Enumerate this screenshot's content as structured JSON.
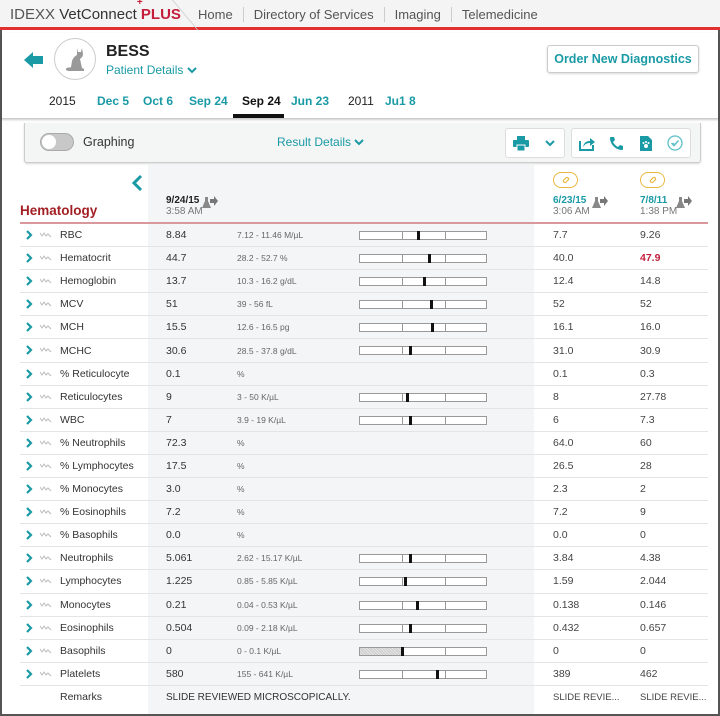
{
  "app": {
    "brand_prefix": "IDEXX",
    "brand_name": "VetConnect",
    "brand_suffix": "PLUS",
    "nav": [
      "Home",
      "Directory of Services",
      "Imaging",
      "Telemedicine"
    ]
  },
  "patient": {
    "name": "BESS",
    "details_label": "Patient Details",
    "order_button": "Order New Diagnostics"
  },
  "timeline": [
    {
      "label": "2015",
      "kind": "year"
    },
    {
      "label": "Dec 5",
      "kind": "date"
    },
    {
      "label": "Oct 6",
      "kind": "date"
    },
    {
      "label": "Sep 24",
      "kind": "date"
    },
    {
      "label": "Sep 24",
      "kind": "selected"
    },
    {
      "label": "Jun 23",
      "kind": "date"
    },
    {
      "label": "2011",
      "kind": "year"
    },
    {
      "label": "Ju1 8",
      "kind": "date"
    }
  ],
  "toolbar": {
    "graphing_label": "Graphing",
    "graphing_on": false,
    "result_details_label": "Result Details",
    "icons": [
      "print-icon",
      "chevron-down-icon",
      "share-icon",
      "phone-icon",
      "pet-document-icon",
      "check-circle-icon"
    ]
  },
  "columns": {
    "current": {
      "date": "9/24/15",
      "time": "3:58 AM"
    },
    "previous": [
      {
        "date": "6/23/15",
        "time": "3:06 AM"
      },
      {
        "date": "7/8/11",
        "time": "1:38 PM"
      }
    ]
  },
  "section": "Hematology",
  "colors": {
    "accent": "#1a9aa5",
    "section_red": "#a31f24",
    "high_value": "#c41e3a",
    "link_badge": "#e8b940"
  },
  "rows": [
    {
      "name": "RBC",
      "value": "8.84",
      "range": "7.12 - 11.46 M/µL",
      "marker": 0.46,
      "prev1": "7.7",
      "prev2": "9.26"
    },
    {
      "name": "Hematocrit",
      "value": "44.7",
      "range": "28.2 - 52.7 %",
      "marker": 0.55,
      "prev1": "40.0",
      "prev2": "47.9",
      "prev2_high": true
    },
    {
      "name": "Hemoglobin",
      "value": "13.7",
      "range": "10.3 - 16.2 g/dL",
      "marker": 0.51,
      "prev1": "12.4",
      "prev2": "14.8"
    },
    {
      "name": "MCV",
      "value": "51",
      "range": "39 - 56 fL",
      "marker": 0.56,
      "prev1": "52",
      "prev2": "52"
    },
    {
      "name": "MCH",
      "value": "15.5",
      "range": "12.6 - 16.5 pg",
      "marker": 0.57,
      "prev1": "16.1",
      "prev2": "16.0"
    },
    {
      "name": "MCHC",
      "value": "30.6",
      "range": "28.5 - 37.8 g/dL",
      "marker": 0.4,
      "prev1": "31.0",
      "prev2": "30.9"
    },
    {
      "name": "% Reticulocyte",
      "value": "0.1",
      "range": "%",
      "prev1": "0.1",
      "prev2": "0.3"
    },
    {
      "name": "Reticulocytes",
      "value": "9",
      "range": "3 - 50 K/µL",
      "marker": 0.37,
      "prev1": "8",
      "prev2": "27.78"
    },
    {
      "name": "WBC",
      "value": "7",
      "range": "3.9 - 19 K/µL",
      "marker": 0.4,
      "prev1": "6",
      "prev2": "7.3"
    },
    {
      "name": "% Neutrophils",
      "value": "72.3",
      "range": "%",
      "prev1": "64.0",
      "prev2": "60"
    },
    {
      "name": "% Lymphocytes",
      "value": "17.5",
      "range": "%",
      "prev1": "26.5",
      "prev2": "28"
    },
    {
      "name": "% Monocytes",
      "value": "3.0",
      "range": "%",
      "prev1": "2.3",
      "prev2": "2"
    },
    {
      "name": "% Eosinophils",
      "value": "7.2",
      "range": "%",
      "prev1": "7.2",
      "prev2": "9"
    },
    {
      "name": "% Basophils",
      "value": "0.0",
      "range": "%",
      "prev1": "0.0",
      "prev2": "0"
    },
    {
      "name": "Neutrophils",
      "value": "5.061",
      "range": "2.62 - 15.17 K/µL",
      "marker": 0.4,
      "prev1": "3.84",
      "prev2": "4.38"
    },
    {
      "name": "Lymphocytes",
      "value": "1.225",
      "range": "0.85 - 5.85 K/µL",
      "marker": 0.36,
      "prev1": "1.59",
      "prev2": "2.044"
    },
    {
      "name": "Monocytes",
      "value": "0.21",
      "range": "0.04 - 0.53 K/µL",
      "marker": 0.45,
      "prev1": "0.138",
      "prev2": "0.146"
    },
    {
      "name": "Eosinophils",
      "value": "0.504",
      "range": "0.09 - 2.18 K/µL",
      "marker": 0.4,
      "prev1": "0.432",
      "prev2": "0.657"
    },
    {
      "name": "Basophils",
      "value": "0",
      "range": "0 - 0.1 K/µL",
      "marker": 0.33,
      "low_fill": true,
      "prev1": "0",
      "prev2": "0"
    },
    {
      "name": "Platelets",
      "value": "580",
      "range": "155 - 641 K/µL",
      "marker": 0.61,
      "prev1": "389",
      "prev2": "462"
    }
  ],
  "remarks": {
    "label": "Remarks",
    "value": "SLIDE REVIEWED MICROSCOPICALLY.",
    "prev1": "SLIDE REVIE...",
    "prev2": "SLIDE REVIE..."
  }
}
